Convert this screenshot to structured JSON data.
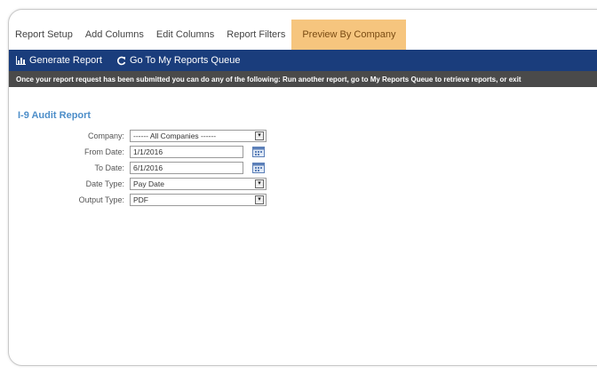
{
  "tabs": [
    {
      "label": "Report Setup"
    },
    {
      "label": "Add Columns"
    },
    {
      "label": "Edit Columns"
    },
    {
      "label": "Report Filters"
    },
    {
      "label": "Preview By Company",
      "active": true
    }
  ],
  "toolbar": {
    "generate_label": "Generate Report",
    "queue_label": "Go To My Reports Queue"
  },
  "info_bar": "Once your report request has been submitted you can do any of the following: Run another report, go to My Reports Queue to retrieve reports, or exit",
  "report": {
    "title": "I-9 Audit Report",
    "fields": {
      "company": {
        "label": "Company:",
        "value": "------ All Companies ------"
      },
      "from_date": {
        "label": "From Date:",
        "value": "1/1/2016"
      },
      "to_date": {
        "label": "To Date:",
        "value": "6/1/2016"
      },
      "date_type": {
        "label": "Date Type:",
        "value": "Pay Date"
      },
      "output_type": {
        "label": "Output Type:",
        "value": "PDF"
      }
    }
  },
  "colors": {
    "toolbar_bg": "#1a3d7c",
    "info_bg": "#4a4a4a",
    "active_tab_bg": "#f6c57e",
    "title_color": "#4d8ec9"
  },
  "icons": {
    "generate": "bar-chart-icon",
    "queue": "refresh-icon",
    "calendar": "calendar-icon",
    "dropdown": "chevron-down-icon"
  }
}
